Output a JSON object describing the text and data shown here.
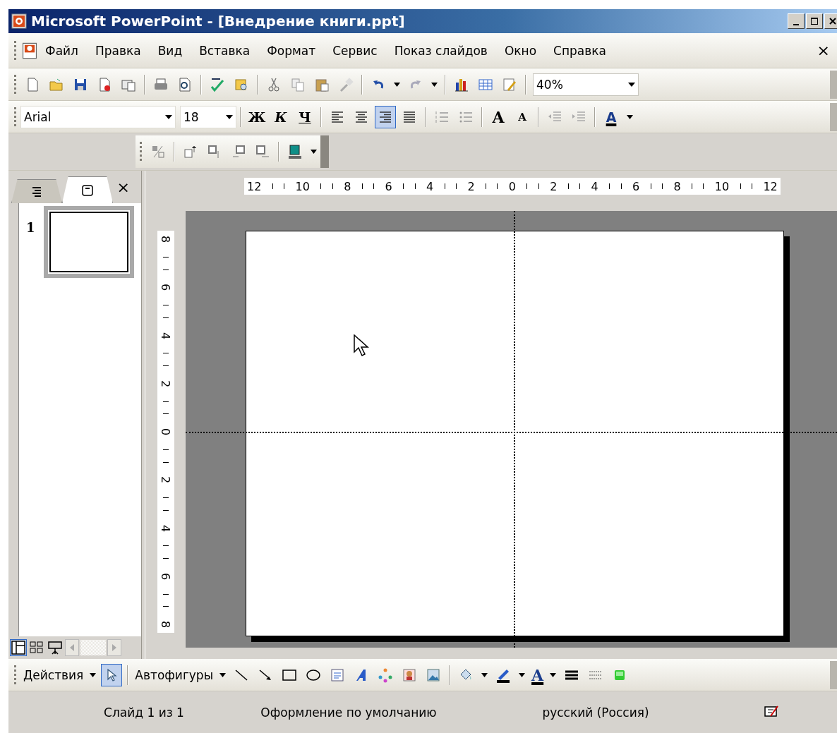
{
  "window": {
    "title": "Microsoft PowerPoint - [Внедрение книги.ppt]"
  },
  "menu": {
    "items": [
      "Файл",
      "Правка",
      "Вид",
      "Вставка",
      "Формат",
      "Сервис",
      "Показ слайдов",
      "Окно",
      "Справка"
    ],
    "close": "×"
  },
  "standard_toolbar": {
    "zoom": "40%"
  },
  "formatting_toolbar": {
    "font": "Arial",
    "size": "18",
    "bold": "Ж",
    "italic": "К",
    "underline": "Ч",
    "alignment": [
      {
        "selected": false
      },
      {
        "selected": false
      },
      {
        "selected": true
      },
      {
        "selected": false
      }
    ],
    "grow_font": "A",
    "shrink_font": "A",
    "font_color": "A"
  },
  "pane": {
    "tabs": [
      {
        "kind": "outline",
        "selected": false
      },
      {
        "kind": "slides",
        "selected": true
      }
    ],
    "close": "×",
    "slides": [
      {
        "number": "1",
        "selected": true
      }
    ],
    "views": [
      {
        "kind": "normal",
        "selected": true
      },
      {
        "kind": "sorter",
        "selected": false
      },
      {
        "kind": "show",
        "selected": false
      }
    ]
  },
  "rulers": {
    "horizontal": [
      "12",
      "10",
      "8",
      "6",
      "4",
      "2",
      "0",
      "2",
      "4",
      "6",
      "8",
      "10",
      "12"
    ],
    "vertical": [
      "8",
      "6",
      "4",
      "2",
      "0",
      "2",
      "4",
      "6",
      "8"
    ]
  },
  "drawing_toolbar": {
    "actions": "Действия",
    "select_tool": {
      "selected": true
    },
    "autoshapes": "Автофигуры",
    "font_color": "A"
  },
  "status_bar": {
    "slide": "Слайд 1 из 1",
    "design": "Оформление по умолчанию",
    "language": "русский (Россия)"
  }
}
